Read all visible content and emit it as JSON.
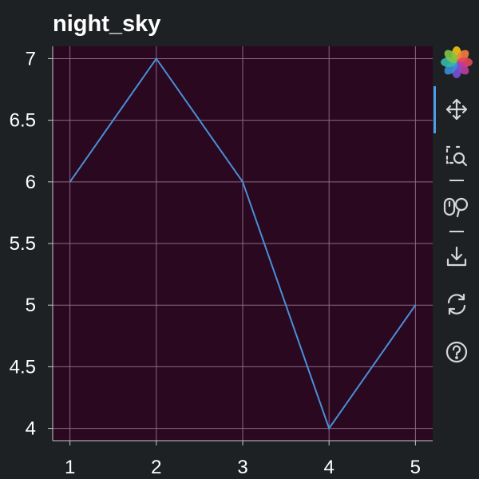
{
  "chart_data": {
    "type": "line",
    "title": "night_sky",
    "x": [
      1,
      2,
      3,
      4,
      5
    ],
    "series": [
      {
        "values": [
          6,
          7,
          6,
          4,
          5
        ]
      }
    ],
    "x_ticks": [
      "1",
      "2",
      "3",
      "4",
      "5"
    ],
    "y_ticks": [
      "4",
      "4.5",
      "5",
      "5.5",
      "6",
      "6.5",
      "7"
    ],
    "xlim": [
      0.8,
      5.2
    ],
    "ylim": [
      3.9,
      7.1
    ],
    "grid": true,
    "colors": {
      "plot_background": "#2a0820",
      "grid": "#8a6a84",
      "line": "#4a8fd8",
      "figure_background": "#1e2124"
    }
  },
  "toolbar": {
    "tools": [
      {
        "name": "logo-icon"
      },
      {
        "name": "pan-icon"
      },
      {
        "name": "box-zoom-icon"
      },
      {
        "name": "wheel-zoom-icon"
      },
      {
        "name": "save-icon"
      },
      {
        "name": "reset-icon"
      },
      {
        "name": "help-icon"
      }
    ]
  }
}
